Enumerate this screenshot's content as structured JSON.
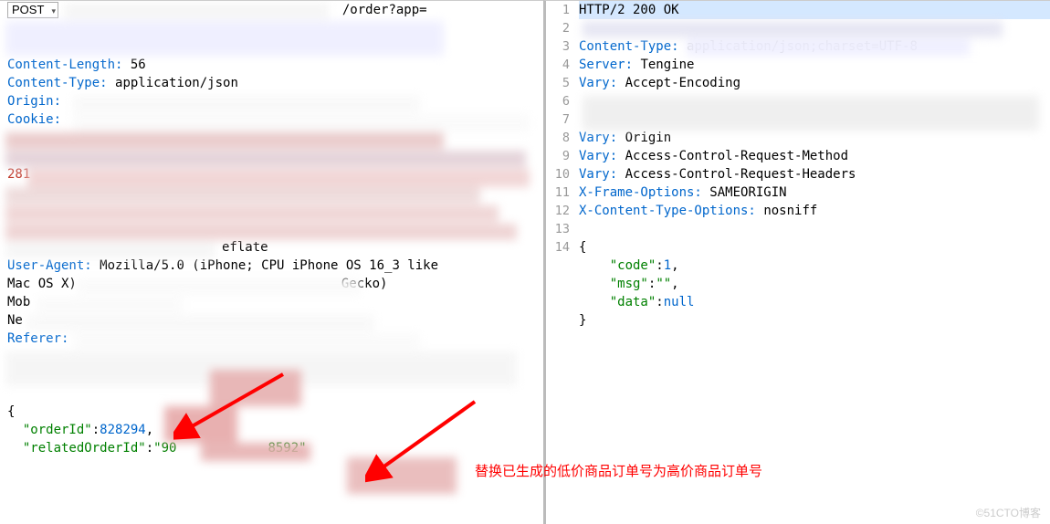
{
  "request": {
    "method": "POST",
    "url_fragment": "/order?app=",
    "headers": {
      "content_length_k": "Content-Length:",
      "content_length_v": "56",
      "content_type_k": "Content-Type:",
      "content_type_v": "application/json",
      "origin_k": "Origin:",
      "cookie_k": "Cookie:",
      "encoding_fragment": "eflate",
      "user_agent_k": "User-Agent:",
      "user_agent_v1": "Mozilla/5.0 (iPhone; CPU iPhone OS 16_3 like",
      "user_agent_v2": "Mac OS X)",
      "user_agent_gecko": "Gecko)",
      "mob_prefix": "Mob",
      "ne_prefix": "Ne",
      "referer_k": "Referer:",
      "partial_281": "281"
    },
    "body": {
      "open_brace": "{",
      "order_id_k": "\"orderId\"",
      "order_id_v": "828294",
      "related_k": "\"relatedOrderId\"",
      "related_v1": "\"90",
      "related_v2": "8592\""
    }
  },
  "response": {
    "status": "HTTP/2 200 OK",
    "content_type_k": "Content-Type:",
    "content_type_frag": "application/json;charset=UTF-8",
    "server_k": "Server:",
    "server_v": "Tengine",
    "vary_k": "Vary:",
    "vary1": "Accept-Encoding",
    "vary2": "Origin",
    "vary3": "Access-Control-Request-Method",
    "vary4": "Access-Control-Request-Headers",
    "xframe_k": "X-Frame-Options:",
    "xframe_v": "SAMEORIGIN",
    "xcto_k": "X-Content-Type-Options:",
    "xcto_v": "nosniff",
    "body": {
      "open": "{",
      "code_k": "\"code\"",
      "code_v": "1",
      "msg_k": "\"msg\"",
      "msg_v": "\"\"",
      "data_k": "\"data\"",
      "data_v": "null",
      "close": "}"
    }
  },
  "annotation": {
    "text": "替换已生成的低价商品订单号为高价商品订单号"
  },
  "gutter": {
    "r": [
      "1",
      "2",
      "3",
      "4",
      "5",
      "6",
      "7",
      "8",
      "9",
      "10",
      "11",
      "12",
      "13",
      "14"
    ]
  },
  "watermark": "©51CTO博客"
}
